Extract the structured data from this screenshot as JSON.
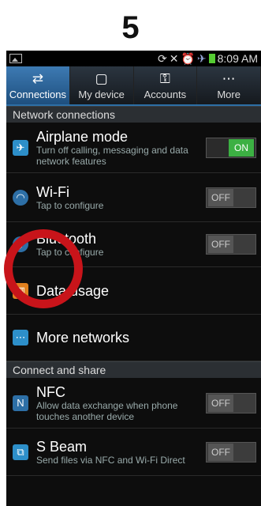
{
  "step_number": "5",
  "status_bar": {
    "time": "8:09 AM",
    "icons": [
      "image-icon",
      "sync-icon",
      "mute-icon",
      "alarm-icon",
      "signal-icon",
      "battery-icon"
    ]
  },
  "tabs": [
    {
      "label": "Connections",
      "icon": "connections-icon",
      "active": true
    },
    {
      "label": "My device",
      "icon": "my-device-icon",
      "active": false
    },
    {
      "label": "Accounts",
      "icon": "accounts-icon",
      "active": false
    },
    {
      "label": "More",
      "icon": "more-icon",
      "active": false
    }
  ],
  "sections": {
    "network": "Network connections",
    "connect_share": "Connect and share"
  },
  "rows": {
    "airplane": {
      "title": "Airplane mode",
      "sub": "Turn off calling, messaging and data network features",
      "toggle": "ON"
    },
    "wifi": {
      "title": "Wi-Fi",
      "sub": "Tap to configure",
      "toggle": "OFF"
    },
    "bluetooth": {
      "title": "Bluetooth",
      "sub": "Tap to configure",
      "toggle": "OFF"
    },
    "data_usage": {
      "title": "Data usage"
    },
    "more_networks": {
      "title": "More networks"
    },
    "nfc": {
      "title": "NFC",
      "sub": "Allow data exchange when phone touches another device",
      "toggle": "OFF"
    },
    "sbeam": {
      "title": "S Beam",
      "sub": "Send files via NFC and Wi-Fi Direct",
      "toggle": "OFF"
    }
  },
  "colors": {
    "accent": "#2d6fa6",
    "highlight_circle": "#c8141a",
    "toggle_on": "#3cb043"
  }
}
